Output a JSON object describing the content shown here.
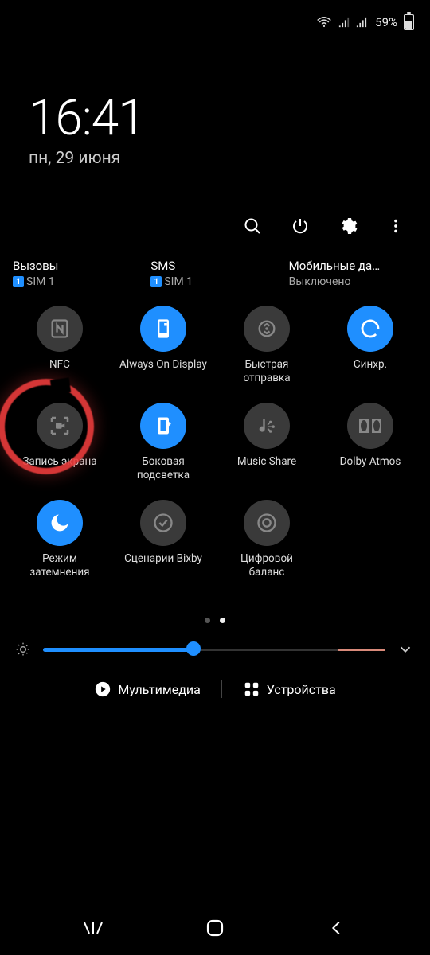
{
  "status": {
    "battery_pct": "59%"
  },
  "clock": {
    "time": "16:41",
    "date": "пн, 29 июня"
  },
  "conn": [
    {
      "title": "Вызовы",
      "sub": "SIM 1",
      "show_sim_badge": true
    },
    {
      "title": "SMS",
      "sub": "SIM 1",
      "show_sim_badge": true
    },
    {
      "title": "Мобильные да…",
      "sub": "Выключено",
      "show_sim_badge": false
    }
  ],
  "tiles": [
    {
      "icon": "nfc",
      "label": "NFC",
      "on": false
    },
    {
      "icon": "aod",
      "label": "Always On Display",
      "on": true
    },
    {
      "icon": "quickshare",
      "label": "Быстрая отправка",
      "on": false
    },
    {
      "icon": "sync",
      "label": "Синхр.",
      "on": true
    },
    {
      "icon": "screenrec",
      "label": "Запись экрана",
      "on": false,
      "annotated": true
    },
    {
      "icon": "edge",
      "label": "Боковая подсветка",
      "on": true
    },
    {
      "icon": "musicshare",
      "label": "Music Share",
      "on": false
    },
    {
      "icon": "dolby",
      "label": "Dolby Atmos",
      "on": false
    },
    {
      "icon": "dark",
      "label": "Режим затемнения",
      "on": true
    },
    {
      "icon": "bixby",
      "label": "Сценарии Bixby",
      "on": false
    },
    {
      "icon": "wellbeing",
      "label": "Цифровой баланс",
      "on": false
    }
  ],
  "bottom": {
    "media": "Мультимедиа",
    "devices": "Устройства"
  },
  "sim_badge_text": "1"
}
